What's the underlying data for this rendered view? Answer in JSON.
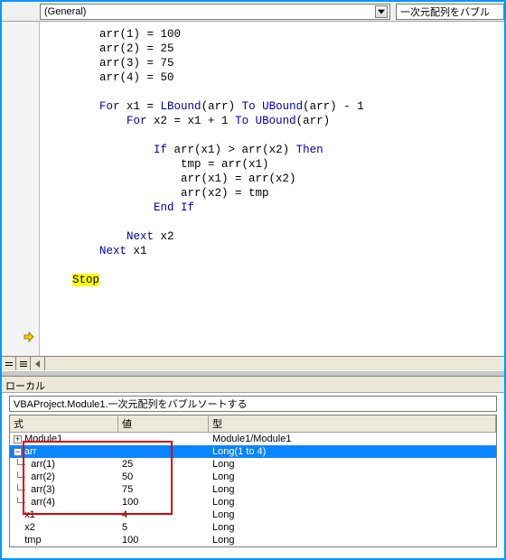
{
  "dropdowns": {
    "object": "(General)",
    "procedure": "一次元配列をバブル"
  },
  "code": {
    "l1": "arr(1) = 100",
    "l2": "arr(2) = 25",
    "l3": "arr(3) = 75",
    "l4": "arr(4) = 50",
    "for1_a": "For",
    "for1_b": " x1 = ",
    "for1_c": "LBound",
    "for1_d": "(arr) ",
    "for1_e": "To",
    "for1_f": " ",
    "for1_g": "UBound",
    "for1_h": "(arr) - 1",
    "for2_a": "For",
    "for2_b": " x2 = x1 + 1 ",
    "for2_c": "To",
    "for2_d": " ",
    "for2_e": "UBound",
    "for2_f": "(arr)",
    "if_a": "If",
    "if_b": " arr(x1) > arr(x2) ",
    "if_c": "Then",
    "b1": "tmp = arr(x1)",
    "b2": "arr(x1) = arr(x2)",
    "b3": "arr(x2) = tmp",
    "endif": "End If",
    "next2_a": "Next",
    "next2_b": " x2",
    "next1_a": "Next",
    "next1_b": " x1",
    "stop": "Stop"
  },
  "locals": {
    "title": "ローカル",
    "context": "VBAProject.Module1.一次元配列をバブルソートする",
    "headers": {
      "expr": "式",
      "value": "値",
      "type": "型"
    },
    "rows": [
      {
        "indent": 0,
        "exp": "plus",
        "name": "Module1",
        "value": "",
        "type": "Module1/Module1",
        "sel": false
      },
      {
        "indent": 0,
        "exp": "minus",
        "name": "arr",
        "value": "",
        "type": "Long(1 to 4)",
        "sel": true
      },
      {
        "indent": 1,
        "exp": "",
        "name": "arr(1)",
        "value": "25",
        "type": "Long",
        "sel": false
      },
      {
        "indent": 1,
        "exp": "",
        "name": "arr(2)",
        "value": "50",
        "type": "Long",
        "sel": false
      },
      {
        "indent": 1,
        "exp": "",
        "name": "arr(3)",
        "value": "75",
        "type": "Long",
        "sel": false
      },
      {
        "indent": 1,
        "exp": "",
        "name": "arr(4)",
        "value": "100",
        "type": "Long",
        "sel": false
      },
      {
        "indent": 0,
        "exp": "",
        "name": "x1",
        "value": "4",
        "type": "Long",
        "sel": false
      },
      {
        "indent": 0,
        "exp": "",
        "name": "x2",
        "value": "5",
        "type": "Long",
        "sel": false
      },
      {
        "indent": 0,
        "exp": "",
        "name": "tmp",
        "value": "100",
        "type": "Long",
        "sel": false
      }
    ]
  }
}
